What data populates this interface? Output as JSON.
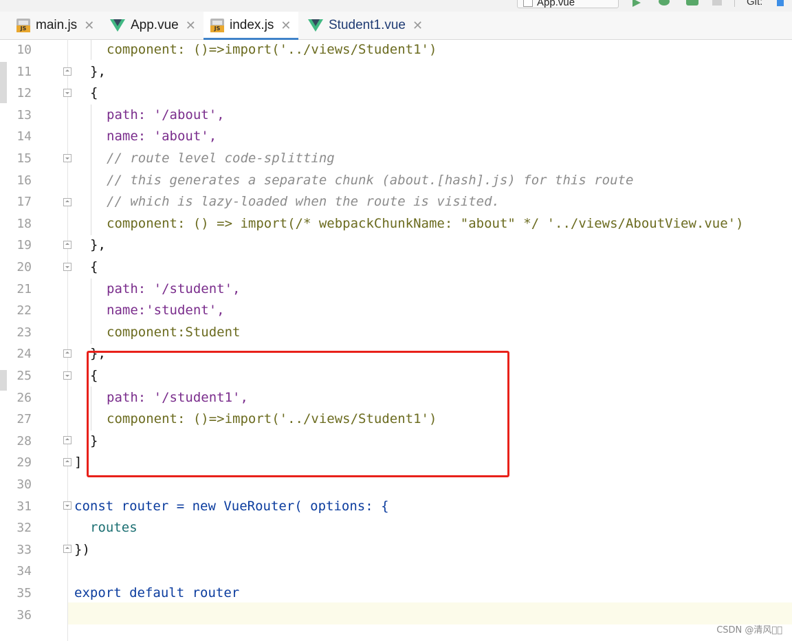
{
  "toolbar": {
    "run_config": "App.vue",
    "right_text": "Git:"
  },
  "tabs": [
    {
      "label": "main.js",
      "icon": "js-file-icon"
    },
    {
      "label": "App.vue",
      "icon": "vue-file-icon"
    },
    {
      "label": "index.js",
      "icon": "js-file-icon"
    },
    {
      "label": "Student1.vue",
      "icon": "vue-file-icon"
    }
  ],
  "active_tab": "index.js",
  "editor": {
    "line_numbers": [
      "10",
      "11",
      "12",
      "13",
      "14",
      "15",
      "16",
      "17",
      "18",
      "19",
      "20",
      "21",
      "22",
      "23",
      "24",
      "25",
      "26",
      "27",
      "28",
      "29",
      "30",
      "31",
      "32",
      "33",
      "34",
      "35",
      "36"
    ],
    "current_line": "36",
    "inlay_hint": "options:"
  },
  "code_lines": [
    "component: ()=>import('../views/Student1')",
    "},",
    "{",
    "path: '/about',",
    "name: 'about',",
    "// route level code-splitting",
    "// this generates a separate chunk (about.[hash].js) for this route",
    "// which is lazy-loaded when the route is visited.",
    "component: () => import(/* webpackChunkName: \"about\" */ '../views/AboutView.vue')",
    "},",
    "{",
    "path: '/student',",
    "name:'student',",
    "component:Student",
    "},",
    "{",
    "path: '/student1',",
    "component: ()=>import('../views/Student1')",
    "}",
    "]",
    "",
    "const router = new VueRouter( options: {",
    "routes",
    "})",
    "",
    "export default router",
    ""
  ],
  "annotation": {
    "color": "#e8211a"
  },
  "watermark": "CSDN @清风\u0000\u0000",
  "colors": {
    "keyword": "#0b3c9e",
    "string": "#0d7a14",
    "property": "#7a2d8c",
    "comment": "#8c8c8c",
    "tab_underline": "#4083c9"
  }
}
